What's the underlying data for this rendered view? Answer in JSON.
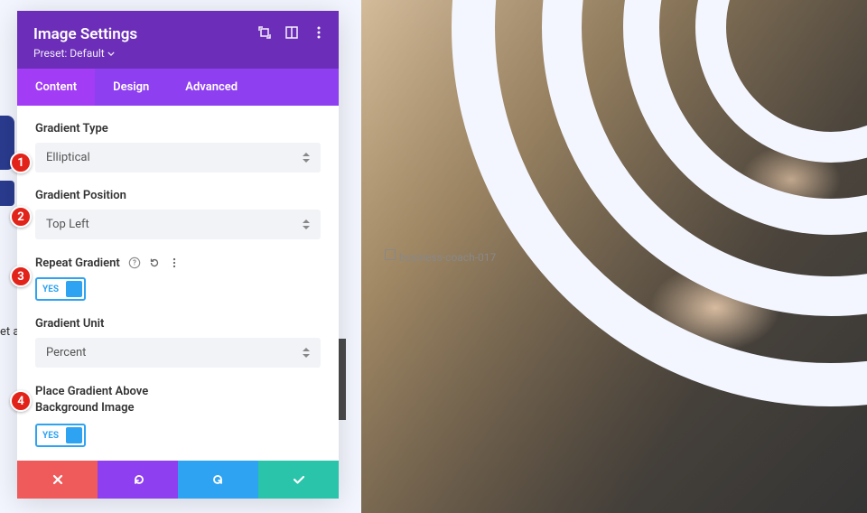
{
  "panel": {
    "title": "Image Settings",
    "preset_prefix": "Preset:",
    "preset_value": "Default"
  },
  "tabs": {
    "content": "Content",
    "design": "Design",
    "advanced": "Advanced"
  },
  "fields": {
    "gradient_type": {
      "label": "Gradient Type",
      "value": "Elliptical"
    },
    "gradient_position": {
      "label": "Gradient Position",
      "value": "Top Left"
    },
    "repeat_gradient": {
      "label": "Repeat Gradient",
      "toggle": "YES"
    },
    "gradient_unit": {
      "label": "Gradient Unit",
      "value": "Percent"
    },
    "place_above": {
      "label": "Place Gradient Above Background Image",
      "toggle": "YES"
    }
  },
  "markers": {
    "m1": "1",
    "m2": "2",
    "m3": "3",
    "m4": "4"
  },
  "preview": {
    "module_name": "business-coach-017"
  },
  "side": {
    "text": "et a"
  }
}
